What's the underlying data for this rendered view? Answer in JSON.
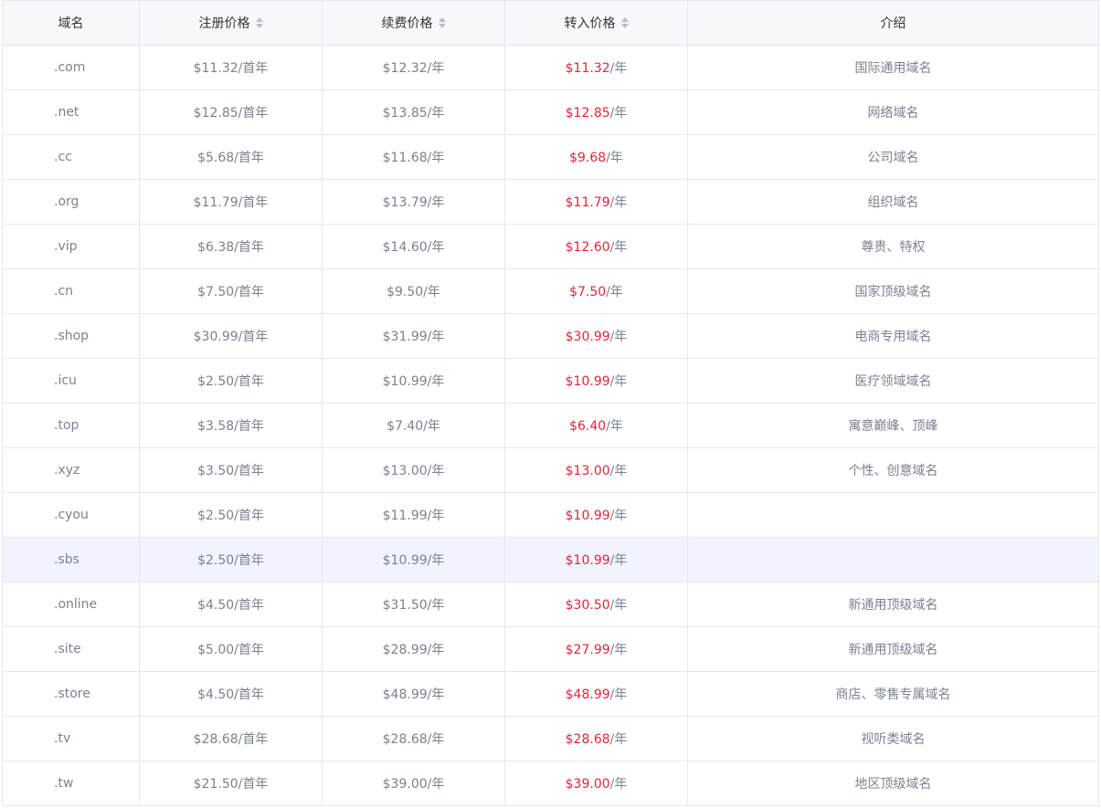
{
  "headers": {
    "domain": "域名",
    "register": "注册价格",
    "renew": "续费价格",
    "transfer": "转入价格",
    "intro": "介绍"
  },
  "rows": [
    {
      "domain": ".com",
      "register": "$11.32/首年",
      "renew": "$12.32/年",
      "transfer_price": "$11.32",
      "transfer_unit": "/年",
      "intro": "国际通用域名"
    },
    {
      "domain": ".net",
      "register": "$12.85/首年",
      "renew": "$13.85/年",
      "transfer_price": "$12.85",
      "transfer_unit": "/年",
      "intro": "网络域名"
    },
    {
      "domain": ".cc",
      "register": "$5.68/首年",
      "renew": "$11.68/年",
      "transfer_price": "$9.68",
      "transfer_unit": "/年",
      "intro": "公司域名"
    },
    {
      "domain": ".org",
      "register": "$11.79/首年",
      "renew": "$13.79/年",
      "transfer_price": "$11.79",
      "transfer_unit": "/年",
      "intro": "组织域名"
    },
    {
      "domain": ".vip",
      "register": "$6.38/首年",
      "renew": "$14.60/年",
      "transfer_price": "$12.60",
      "transfer_unit": "/年",
      "intro": "尊贵、特权"
    },
    {
      "domain": ".cn",
      "register": "$7.50/首年",
      "renew": "$9.50/年",
      "transfer_price": "$7.50",
      "transfer_unit": "/年",
      "intro": "国家顶级域名"
    },
    {
      "domain": ".shop",
      "register": "$30.99/首年",
      "renew": "$31.99/年",
      "transfer_price": "$30.99",
      "transfer_unit": "/年",
      "intro": "电商专用域名"
    },
    {
      "domain": ".icu",
      "register": "$2.50/首年",
      "renew": "$10.99/年",
      "transfer_price": "$10.99",
      "transfer_unit": "/年",
      "intro": "医疗领域域名"
    },
    {
      "domain": ".top",
      "register": "$3.58/首年",
      "renew": "$7.40/年",
      "transfer_price": "$6.40",
      "transfer_unit": "/年",
      "intro": "寓意巅峰、顶峰"
    },
    {
      "domain": ".xyz",
      "register": "$3.50/首年",
      "renew": "$13.00/年",
      "transfer_price": "$13.00",
      "transfer_unit": "/年",
      "intro": "个性、创意域名"
    },
    {
      "domain": ".cyou",
      "register": "$2.50/首年",
      "renew": "$11.99/年",
      "transfer_price": "$10.99",
      "transfer_unit": "/年",
      "intro": ""
    },
    {
      "domain": ".sbs",
      "register": "$2.50/首年",
      "renew": "$10.99/年",
      "transfer_price": "$10.99",
      "transfer_unit": "/年",
      "intro": ""
    },
    {
      "domain": ".online",
      "register": "$4.50/首年",
      "renew": "$31.50/年",
      "transfer_price": "$30.50",
      "transfer_unit": "/年",
      "intro": "新通用顶级域名"
    },
    {
      "domain": ".site",
      "register": "$5.00/首年",
      "renew": "$28.99/年",
      "transfer_price": "$27.99",
      "transfer_unit": "/年",
      "intro": "新通用顶级域名"
    },
    {
      "domain": ".store",
      "register": "$4.50/首年",
      "renew": "$48.99/年",
      "transfer_price": "$48.99",
      "transfer_unit": "/年",
      "intro": "商店、零售专属域名"
    },
    {
      "domain": ".tv",
      "register": "$28.68/首年",
      "renew": "$28.68/年",
      "transfer_price": "$28.68",
      "transfer_unit": "/年",
      "intro": "视听类域名"
    },
    {
      "domain": ".tw",
      "register": "$21.50/首年",
      "renew": "$39.00/年",
      "transfer_price": "$39.00",
      "transfer_unit": "/年",
      "intro": "地区顶级域名"
    }
  ],
  "highlighted_row": 11,
  "colors": {
    "accent_price": "#e0263a",
    "text_muted": "#7a8191",
    "header_bg": "#f7f8fc",
    "highlight_bg": "#f1f4fd"
  },
  "icons": {
    "sort": "sort-caret-icon"
  }
}
